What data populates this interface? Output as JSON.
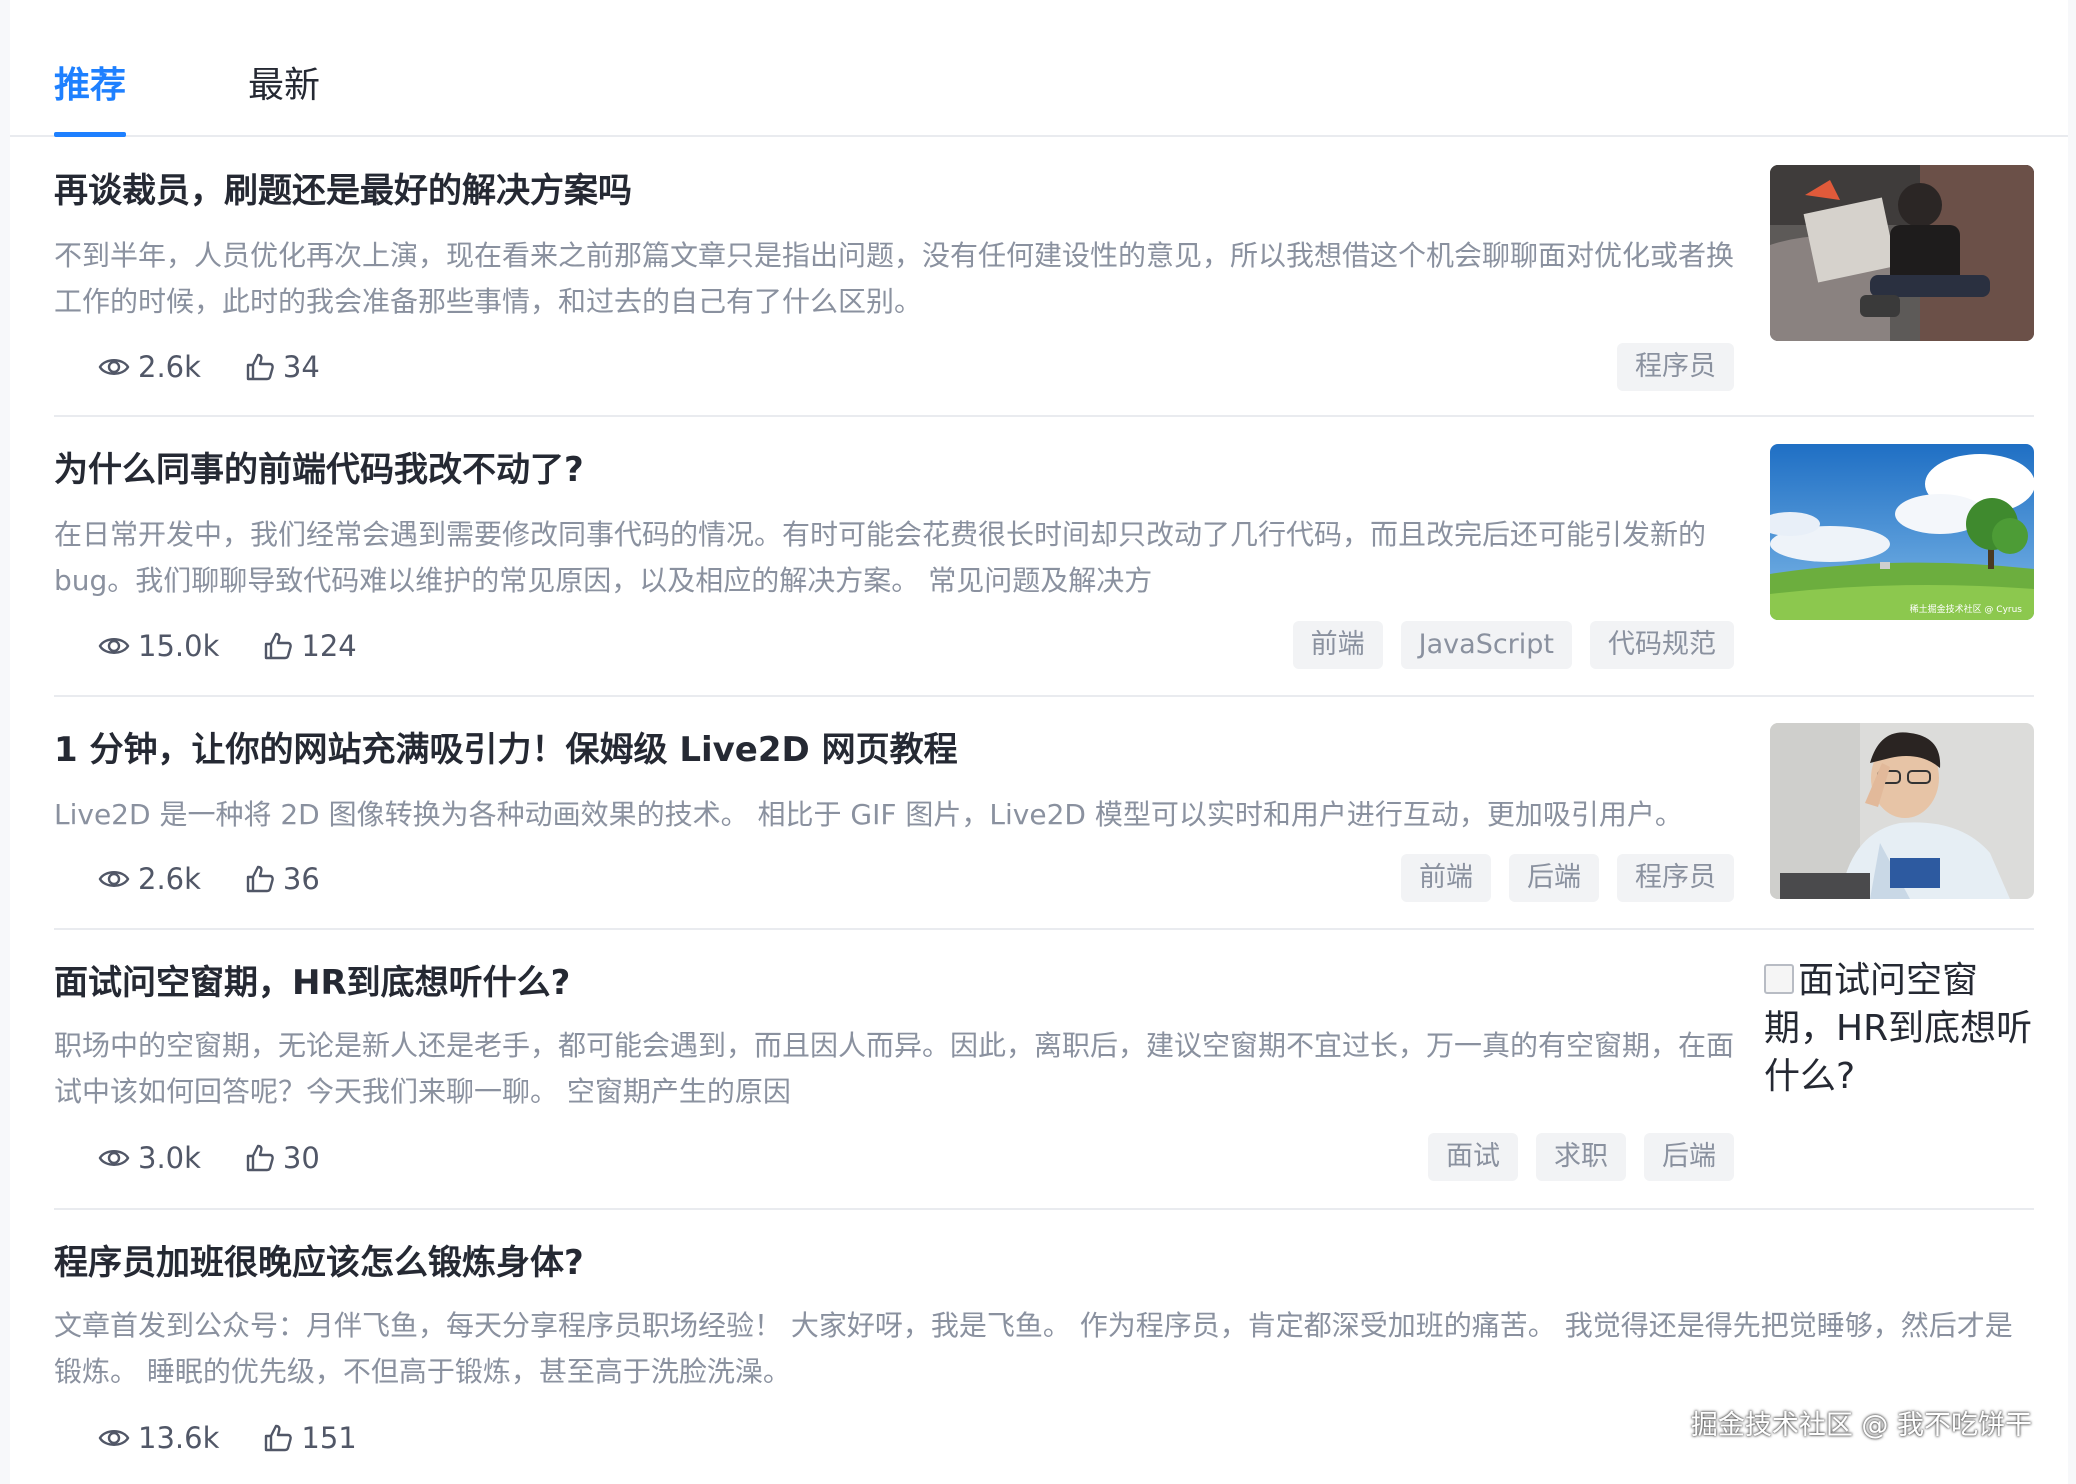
{
  "tabs": [
    {
      "label": "推荐",
      "active": true
    },
    {
      "label": "最新",
      "active": false
    }
  ],
  "articles": [
    {
      "title": "再谈裁员，刷题还是最好的解决方案吗",
      "abstract": "不到半年，人员优化再次上演，现在看来之前那篇文章只是指出问题，没有任何建设性的意见，所以我想借这个机会聊聊面对优化或者换工作的时候，此时的我会准备那些事情，和过去的自己有了什么区别。",
      "views": "2.6k",
      "likes": "34",
      "tags": [
        "程序员"
      ],
      "thumbnail": "photo-newspaper-reader"
    },
    {
      "title": "为什么同事的前端代码我改不动了?",
      "abstract": "在日常开发中，我们经常会遇到需要修改同事代码的情况。有时可能会花费很长时间却只改动了几行代码，而且改完后还可能引发新的bug。我们聊聊导致代码难以维护的常见原因，以及相应的解决方案。 常见问题及解决方",
      "views": "15.0k",
      "likes": "124",
      "tags": [
        "前端",
        "JavaScript",
        "代码规范"
      ],
      "thumbnail": "illustration-sky-meadow",
      "thumbnail_caption": "稀土掘金技术社区 @ Cyrus"
    },
    {
      "title": "1 分钟，让你的网站充满吸引力！保姆级 Live2D 网页教程",
      "abstract": "Live2D 是一种将 2D 图像转换为各种动画效果的技术。 相比于 GIF 图片，Live2D 模型可以实时和用户进行互动，更加吸引用户。",
      "views": "2.6k",
      "likes": "36",
      "tags": [
        "前端",
        "后端",
        "程序员"
      ],
      "thumbnail": "photo-person-with-glasses"
    },
    {
      "title": "面试问空窗期，HR到底想听什么?",
      "abstract": "职场中的空窗期，无论是新人还是老手，都可能会遇到，而且因人而异。因此，离职后，建议空窗期不宜过长，万一真的有空窗期，在面试中该如何回答呢？今天我们来聊一聊。 空窗期产生的原因",
      "views": "3.0k",
      "likes": "30",
      "tags": [
        "面试",
        "求职",
        "后端"
      ],
      "thumbnail_alt": "面试问空窗期，HR到底想听什么?"
    },
    {
      "title": "程序员加班很晚应该怎么锻炼身体?",
      "abstract": "文章首发到公众号：月伴飞鱼，每天分享程序员职场经验！ 大家好呀，我是飞鱼。 作为程序员，肯定都深受加班的痛苦。 我觉得还是得先把觉睡够，然后才是锻炼。 睡眠的优先级，不但高于锻炼，甚至高于洗脸洗澡。",
      "views": "13.6k",
      "likes": "151",
      "tags": []
    }
  ],
  "watermark": "掘金技术社区 @ 我不吃饼干",
  "colors": {
    "accent": "#1e80ff",
    "text": "#252933",
    "muted": "#8a919f",
    "tag_bg": "#f2f3f5"
  }
}
